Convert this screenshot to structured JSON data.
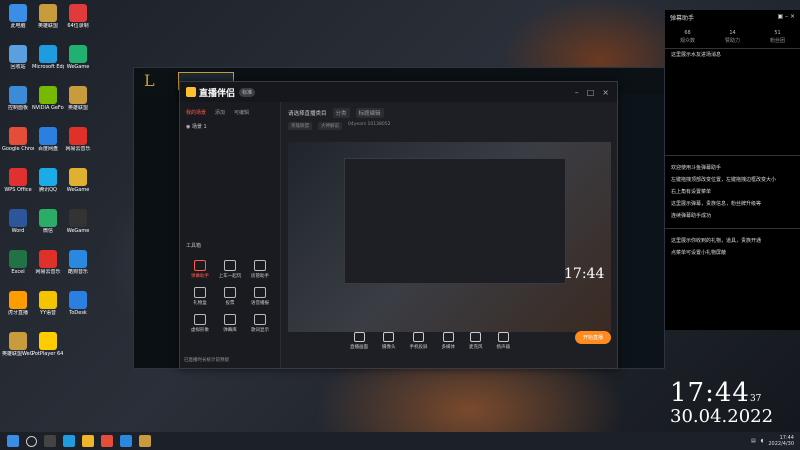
{
  "desktop": {
    "icons": [
      {
        "label": "此电脑",
        "color": "#3a8ee6"
      },
      {
        "label": "英雄联盟",
        "color": "#c89b3c"
      },
      {
        "label": "64位录制",
        "color": "#e03a3a"
      },
      {
        "label": "回收站",
        "color": "#5aa0e0"
      },
      {
        "label": "Microsoft Edge",
        "color": "#1f9be0"
      },
      {
        "label": "WeGame",
        "color": "#20b070"
      },
      {
        "label": "控制面板",
        "color": "#3c8ad8"
      },
      {
        "label": "NVIDIA GeForce",
        "color": "#76b900"
      },
      {
        "label": "英雄联盟",
        "color": "#c89b3c"
      },
      {
        "label": "Google Chrome",
        "color": "#e44d3a"
      },
      {
        "label": "百度网盘",
        "color": "#2a7fe0"
      },
      {
        "label": "网易云音乐",
        "color": "#e0302a"
      },
      {
        "label": "WPS Office",
        "color": "#e03030"
      },
      {
        "label": "腾讯QQ",
        "color": "#1aabe8"
      },
      {
        "label": "WeGame",
        "color": "#e0b030"
      },
      {
        "label": "Word",
        "color": "#2b579a"
      },
      {
        "label": "微信",
        "color": "#2aae67"
      },
      {
        "label": "WeGame",
        "color": "#333"
      },
      {
        "label": "Excel",
        "color": "#217346"
      },
      {
        "label": "网易云音乐",
        "color": "#e0302a"
      },
      {
        "label": "酷狗音乐",
        "color": "#2a88e0"
      },
      {
        "label": "虎牙直播",
        "color": "#ff9c00"
      },
      {
        "label": "YY语音",
        "color": "#f5c400"
      },
      {
        "label": "ToDesk",
        "color": "#2a7fe0"
      },
      {
        "label": "英雄联盟WeGame版",
        "color": "#c89b3c"
      },
      {
        "label": "PotPlayer 64 bit",
        "color": "#ffcc00"
      }
    ]
  },
  "lol_client": {
    "logo": "L"
  },
  "live_app": {
    "title": "直播伴侣",
    "badge": "标准",
    "tabs": [
      "我的场景",
      "添加",
      "可编辑"
    ],
    "scene": "场景 1",
    "tools_heading": "工具箱",
    "tools": [
      "弹幕助手",
      "上车一起玩",
      "房管助手",
      "礼物盒",
      "投票",
      "语音播报",
      "虚拟形象",
      "弹幕库",
      "歌词显示"
    ],
    "footer": "已直播时长统计前预留",
    "preview_title": "请选择直播类目",
    "preview_pill1": "分类",
    "preview_pill2": "标题编辑",
    "sub_pill1": "英雄联盟",
    "sub_pill2": "大神解说",
    "sub_text": "04years 10138052",
    "bottom_tools": [
      "直播画面",
      "摄像头",
      "手机投屏",
      "多媒体",
      "麦克风",
      "扬声器"
    ],
    "start_button": "开始直播",
    "inner_clock": "17:44"
  },
  "side_panel": {
    "title": "弹幕助手",
    "stats": [
      "68",
      "14",
      "51"
    ],
    "stat_tabs": [
      "观众数",
      "赞助力",
      "粉丝团"
    ],
    "msg_top": "这里展示水友进场消息",
    "msg_block": [
      "欢迎使用斗鱼弹幕助手",
      "左键拖拽顶部改变位置，左键拖拽边框改变大小",
      "右上角有设置菜单",
      "这里展示弹幕，贵族信息，粉丝牌升级等",
      "连续弹幕助手成功"
    ],
    "msg_bottom": [
      "这里展示你收到的礼物，道具，贵族开通",
      "点菜单可设置小礼物屏蔽"
    ]
  },
  "clock": {
    "time": "17:44",
    "seconds": "37",
    "date": "30.04.2022"
  },
  "taskbar": {
    "icons": [
      "start",
      "search",
      "taskview",
      "edge",
      "explorer",
      "chrome",
      "kugou",
      "lol"
    ],
    "tray_time": "17:44",
    "tray_date": "2022/4/30"
  }
}
